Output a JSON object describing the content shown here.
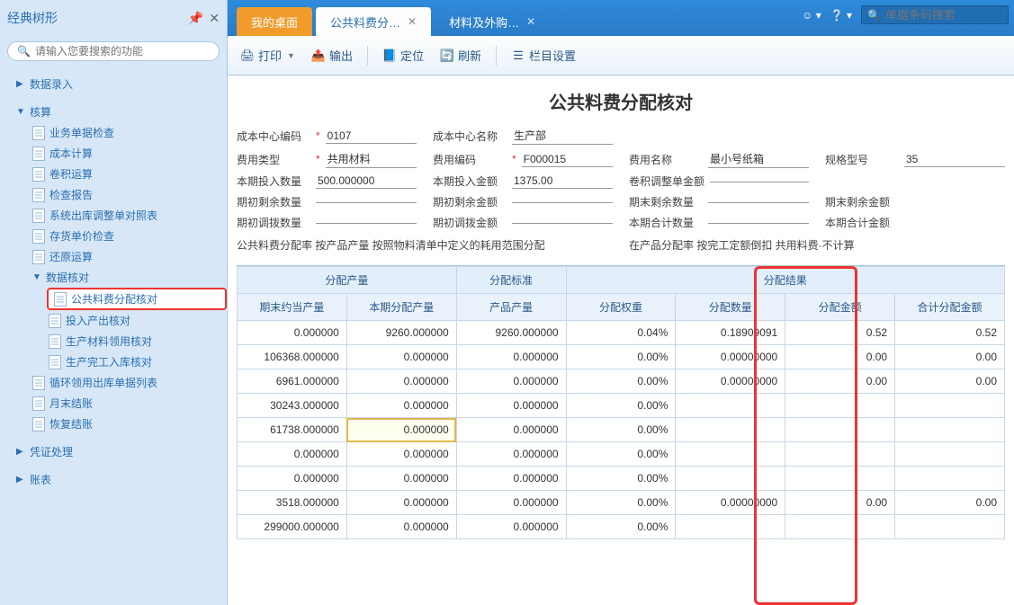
{
  "sidebar": {
    "title": "经典树形",
    "search_placeholder": "请输入您要搜索的功能",
    "nodes": {
      "data_entry": "数据录入",
      "accounting": "核算",
      "acc_children": {
        "biz_doc_check": "业务单据检查",
        "cost_calc": "成本计算",
        "volume_calc": "卷积运算",
        "check_report": "检查报告",
        "sys_out_adj": "系统出库调整单对照表",
        "inv_price_check": "存货单价检查",
        "restore_calc": "还原运算",
        "data_verify": "数据核对",
        "dv_children": {
          "public_material": "公共料费分配核对",
          "input_output": "投入产出核对",
          "prod_material_use": "生产材料领用核对",
          "prod_complete_in": "生产完工入库核对"
        },
        "cycle_use_out": "循环领用出库单据列表",
        "month_end": "月末结账",
        "restore_close": "恢复结账"
      },
      "voucher": "凭证处理",
      "report": "账表"
    }
  },
  "tabs": {
    "t1": "我的桌面",
    "t2": "公共料费分…",
    "t3": "材料及外购…"
  },
  "header_right": {
    "barcode_placeholder": "单据条码搜索"
  },
  "toolbar": {
    "print": "打印",
    "export": "输出",
    "locate": "定位",
    "refresh": "刷新",
    "columns": "栏目设置"
  },
  "page": {
    "title": "公共料费分配核对",
    "fields": {
      "cost_center_code_lbl": "成本中心编码",
      "cost_center_code": "0107",
      "cost_center_name_lbl": "成本中心名称",
      "cost_center_name": "生产部",
      "fee_type_lbl": "费用类型",
      "fee_type": "共用材料",
      "fee_code_lbl": "费用编码",
      "fee_code": "F000015",
      "fee_name_lbl": "费用名称",
      "fee_name": "最小号纸箱",
      "spec_lbl": "规格型号",
      "spec": "35",
      "period_in_qty_lbl": "本期投入数量",
      "period_in_qty": "500.000000",
      "period_in_amt_lbl": "本期投入金额",
      "period_in_amt": "1375.00",
      "vol_adj_amt_lbl": "卷积调整单金额",
      "begin_remain_qty_lbl": "期初剩余数量",
      "begin_remain_amt_lbl": "期初剩余金额",
      "end_remain_qty_lbl": "期末剩余数量",
      "end_remain_amt_lbl": "期末剩余金额",
      "begin_adj_qty_lbl": "期初调拨数量",
      "begin_adj_amt_lbl": "期初调拨金额",
      "period_total_qty_lbl": "本期合计数量",
      "period_total_amt_lbl": "本期合计金额",
      "note1": "公共料费分配率  按产品产量 按照物料清单中定义的耗用范围分配",
      "note2": "在产品分配率  按完工定额倒扣 共用料费·不计算"
    }
  },
  "table": {
    "group_alloc_yield": "分配产量",
    "group_alloc_std": "分配标准",
    "group_alloc_result": "分配结果",
    "col_end_eq_yield": "期末约当产量",
    "col_period_alloc_yield": "本期分配产量",
    "col_product_yield": "产品产量",
    "col_alloc_weight": "分配权重",
    "col_alloc_qty": "分配数量",
    "col_alloc_amt": "分配金额",
    "col_total_alloc_amt": "合计分配金额",
    "rows": [
      {
        "end_eq_yield": "0.000000",
        "period_alloc_yield": "9260.000000",
        "product_yield": "9260.000000",
        "alloc_weight": "0.04%",
        "alloc_qty": "0.18909091",
        "alloc_amt": "0.52",
        "total_alloc_amt": "0.52"
      },
      {
        "end_eq_yield": "106368.000000",
        "period_alloc_yield": "0.000000",
        "product_yield": "0.000000",
        "alloc_weight": "0.00%",
        "alloc_qty": "0.00000000",
        "alloc_amt": "0.00",
        "total_alloc_amt": "0.00"
      },
      {
        "end_eq_yield": "6961.000000",
        "period_alloc_yield": "0.000000",
        "product_yield": "0.000000",
        "alloc_weight": "0.00%",
        "alloc_qty": "0.00000000",
        "alloc_amt": "0.00",
        "total_alloc_amt": "0.00"
      },
      {
        "end_eq_yield": "30243.000000",
        "period_alloc_yield": "0.000000",
        "product_yield": "0.000000",
        "alloc_weight": "0.00%",
        "alloc_qty": "",
        "alloc_amt": "",
        "total_alloc_amt": ""
      },
      {
        "end_eq_yield": "61738.000000",
        "period_alloc_yield": "0.000000",
        "product_yield": "0.000000",
        "alloc_weight": "0.00%",
        "alloc_qty": "",
        "alloc_amt": "",
        "total_alloc_amt": ""
      },
      {
        "end_eq_yield": "0.000000",
        "period_alloc_yield": "0.000000",
        "product_yield": "0.000000",
        "alloc_weight": "0.00%",
        "alloc_qty": "",
        "alloc_amt": "",
        "total_alloc_amt": ""
      },
      {
        "end_eq_yield": "0.000000",
        "period_alloc_yield": "0.000000",
        "product_yield": "0.000000",
        "alloc_weight": "0.00%",
        "alloc_qty": "",
        "alloc_amt": "",
        "total_alloc_amt": ""
      },
      {
        "end_eq_yield": "3518.000000",
        "period_alloc_yield": "0.000000",
        "product_yield": "0.000000",
        "alloc_weight": "0.00%",
        "alloc_qty": "0.00000000",
        "alloc_amt": "0.00",
        "total_alloc_amt": "0.00"
      },
      {
        "end_eq_yield": "299000.000000",
        "period_alloc_yield": "0.000000",
        "product_yield": "0.000000",
        "alloc_weight": "0.00%",
        "alloc_qty": "",
        "alloc_amt": "",
        "total_alloc_amt": ""
      }
    ]
  }
}
